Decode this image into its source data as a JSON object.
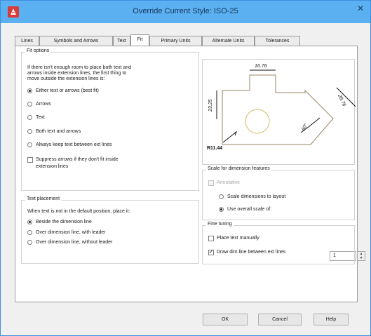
{
  "window": {
    "title": "Override Current Style: ISO-25",
    "close_glyph": "✕",
    "app_icon": "autocad-icon",
    "accent_colors": {
      "titlebar": "#5ab0f0",
      "close_button": "#5ab0f0",
      "preview_lines": "#9a8566",
      "preview_dim": "#111111"
    }
  },
  "tabs": [
    {
      "label": "Lines"
    },
    {
      "label": "Symbols and Arrows"
    },
    {
      "label": "Text"
    },
    {
      "label": "Fit"
    },
    {
      "label": "Primary Units"
    },
    {
      "label": "Alternate Units"
    },
    {
      "label": "Tolerances"
    }
  ],
  "fit_options": {
    "title": "Fit options",
    "description": [
      "If there isn't enough room to place both text and",
      "arrows inside extension lines, the first thing to",
      "move outside the extension lines is:"
    ],
    "radios": [
      {
        "label": "Either text or arrows (best fit)",
        "checked": true
      },
      {
        "label": "Arrows",
        "checked": false
      },
      {
        "label": "Text",
        "checked": false
      },
      {
        "label": "Both text and arrows",
        "checked": false
      },
      {
        "label": "Always keep text between ext lines",
        "checked": false
      }
    ],
    "suppress_arrows_label": [
      "Suppress arrows if they don't fit inside",
      "extension lines"
    ]
  },
  "text_placement": {
    "title": "Text placement",
    "description": "When text is not in the default position, place it:",
    "radios": [
      {
        "label": "Beside the dimension line",
        "checked": true
      },
      {
        "label": "Over dimension line, with leader",
        "checked": false
      },
      {
        "label": "Over dimension line, without leader",
        "checked": false
      }
    ]
  },
  "preview": {
    "dim_1": "16.76",
    "dim_2": "23.25",
    "dim_3": "28.76",
    "dim_4": "R11.44",
    "dim_5": "60°"
  },
  "scale": {
    "title": "Scale for dimension features",
    "annotative_label": "Annotative",
    "layout_label": "Scale dimensions to layout",
    "overall_label": "Use overall scale of:",
    "overall_value": "1"
  },
  "fine_tuning": {
    "title": "Fine tuning",
    "place_text_manually": "Place text manually",
    "draw_dim_line": "Draw dim line between ext lines"
  },
  "buttons": {
    "ok": "OK",
    "cancel": "Cancel",
    "help": "Help"
  }
}
